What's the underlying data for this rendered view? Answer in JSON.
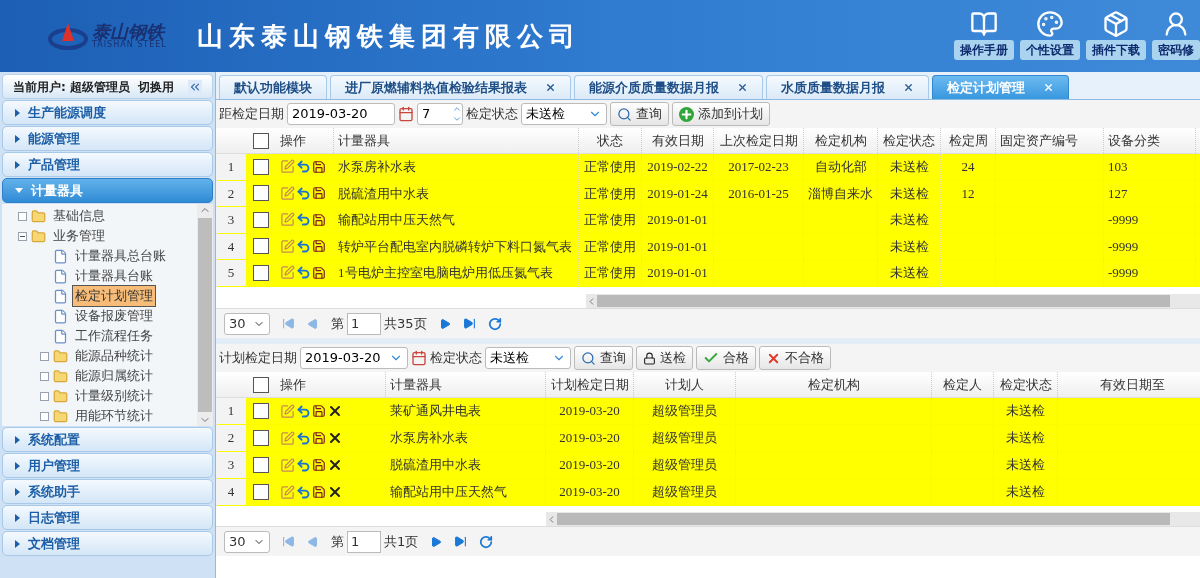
{
  "header": {
    "logo_text": "泰山钢铁",
    "logo_subtext": "TAISHAN STEEL",
    "company": "山东泰山钢铁集团有限公司",
    "links": [
      {
        "label": "操作手册",
        "kind": "manual"
      },
      {
        "label": "个性设置",
        "kind": "palette"
      },
      {
        "label": "插件下载",
        "kind": "plugin"
      },
      {
        "label": "密码修",
        "kind": "user"
      }
    ]
  },
  "sidebar": {
    "user_label": "当前用户: 超级管理员",
    "switch_link": "切换用",
    "sections": [
      {
        "title": "生产能源调度",
        "expanded": false
      },
      {
        "title": "能源管理",
        "expanded": false
      },
      {
        "title": "产品管理",
        "expanded": false
      },
      {
        "title": "计量器具",
        "expanded": true,
        "tree": [
          {
            "label": "基础信息",
            "kind": "folder",
            "expanded": false,
            "selected": false
          },
          {
            "label": "业务管理",
            "kind": "folder",
            "expanded": true,
            "selected": false,
            "children": [
              {
                "label": "计量器具总台账",
                "kind": "page",
                "selected": false
              },
              {
                "label": "计量器具台账",
                "kind": "page",
                "selected": false
              },
              {
                "label": "检定计划管理",
                "kind": "page",
                "selected": true
              },
              {
                "label": "设备报废管理",
                "kind": "page",
                "selected": false
              },
              {
                "label": "工作流程任务",
                "kind": "page",
                "selected": false
              },
              {
                "label": "能源品种统计",
                "kind": "folder",
                "expanded": false,
                "selected": false
              },
              {
                "label": "能源归属统计",
                "kind": "folder",
                "expanded": false,
                "selected": false
              },
              {
                "label": "计量级别统计",
                "kind": "folder",
                "expanded": false,
                "selected": false
              },
              {
                "label": "用能环节统计",
                "kind": "folder",
                "expanded": false,
                "selected": false
              }
            ]
          }
        ]
      },
      {
        "title": "系统配置",
        "expanded": false
      },
      {
        "title": "用户管理",
        "expanded": false
      },
      {
        "title": "系统助手",
        "expanded": false
      },
      {
        "title": "日志管理",
        "expanded": false
      },
      {
        "title": "文档管理",
        "expanded": false
      }
    ]
  },
  "tabs": [
    {
      "label": "默认功能模块",
      "closable": false,
      "selected": false
    },
    {
      "label": "进厂原燃辅料热值检验结果报表",
      "closable": true,
      "selected": false
    },
    {
      "label": "能源介质质量数据月报",
      "closable": true,
      "selected": false
    },
    {
      "label": "水质质量数据月报",
      "closable": true,
      "selected": false
    },
    {
      "label": "检定计划管理",
      "closable": true,
      "selected": true
    }
  ],
  "top_panel": {
    "filters": {
      "date_label": "距检定日期",
      "date": "2019-03-20",
      "days": "7",
      "status_label": "检定状态",
      "status": "未送检"
    },
    "buttons": [
      {
        "label": "查询",
        "kind": "search"
      },
      {
        "label": "添加到计划",
        "kind": "add"
      }
    ],
    "table": {
      "select_all": false,
      "actions_column": "操作",
      "columns": [
        "计量器具",
        "状态",
        "有效日期",
        "上次检定日期",
        "检定机构",
        "检定状态",
        "检定周",
        "固定资产编号",
        "设备分类"
      ],
      "rows": [
        {
          "index": "1",
          "checked": false,
          "highlighted": true,
          "cells": [
            "水泵房补水表",
            "正常使用",
            "2019-02-22",
            "2017-02-23",
            "自动化部",
            "未送检",
            "24",
            "",
            "103"
          ]
        },
        {
          "index": "2",
          "checked": false,
          "highlighted": true,
          "cells": [
            "脱硫渣用中水表",
            "正常使用",
            "2019-01-24",
            "2016-01-25",
            "淄博自来水",
            "未送检",
            "12",
            "",
            "127"
          ]
        },
        {
          "index": "3",
          "checked": false,
          "highlighted": true,
          "cells": [
            "输配站用中压天然气",
            "正常使用",
            "2019-01-01",
            "",
            "",
            "未送检",
            "",
            "",
            "-9999"
          ]
        },
        {
          "index": "4",
          "checked": false,
          "highlighted": true,
          "cells": [
            "转炉平台配电室内脱磷转炉下料口氮气表",
            "正常使用",
            "2019-01-01",
            "",
            "",
            "未送检",
            "",
            "",
            "-9999"
          ]
        },
        {
          "index": "5",
          "checked": false,
          "highlighted": true,
          "cells": [
            "1号电炉主控室电脑电炉用低压氮气表",
            "正常使用",
            "2019-01-01",
            "",
            "",
            "未送检",
            "",
            "",
            "-9999"
          ]
        }
      ]
    },
    "pager": {
      "page_size": "30",
      "page_prefix": "第",
      "page": "1",
      "total": "共35页"
    }
  },
  "bottom_panel": {
    "filters": {
      "date_label": "计划检定日期",
      "date": "2019-03-20",
      "status_label": "检定状态",
      "status": "未送检"
    },
    "buttons": [
      {
        "label": "查询",
        "kind": "search"
      },
      {
        "label": "送检",
        "kind": "lock"
      },
      {
        "label": "合格",
        "kind": "pass"
      },
      {
        "label": "不合格",
        "kind": "fail"
      }
    ],
    "table": {
      "select_all": false,
      "actions_column": "操作",
      "columns": [
        "计量器具",
        "计划检定日期",
        "计划人",
        "检定机构",
        "检定人",
        "检定状态",
        "有效日期至"
      ],
      "rows": [
        {
          "index": "1",
          "checked": false,
          "highlighted": true,
          "cells": [
            "莱矿通风井电表",
            "2019-03-20",
            "超级管理员",
            "",
            "",
            "未送检",
            ""
          ]
        },
        {
          "index": "2",
          "checked": false,
          "highlighted": true,
          "cells": [
            "水泵房补水表",
            "2019-03-20",
            "超级管理员",
            "",
            "",
            "未送检",
            ""
          ]
        },
        {
          "index": "3",
          "checked": false,
          "highlighted": true,
          "cells": [
            "脱硫渣用中水表",
            "2019-03-20",
            "超级管理员",
            "",
            "",
            "未送检",
            ""
          ]
        },
        {
          "index": "4",
          "checked": false,
          "highlighted": true,
          "cells": [
            "输配站用中压天然气",
            "2019-03-20",
            "超级管理员",
            "",
            "",
            "未送检",
            ""
          ]
        }
      ]
    },
    "pager": {
      "page_size": "30",
      "page_prefix": "第",
      "page": "1",
      "total": "共1页"
    }
  }
}
